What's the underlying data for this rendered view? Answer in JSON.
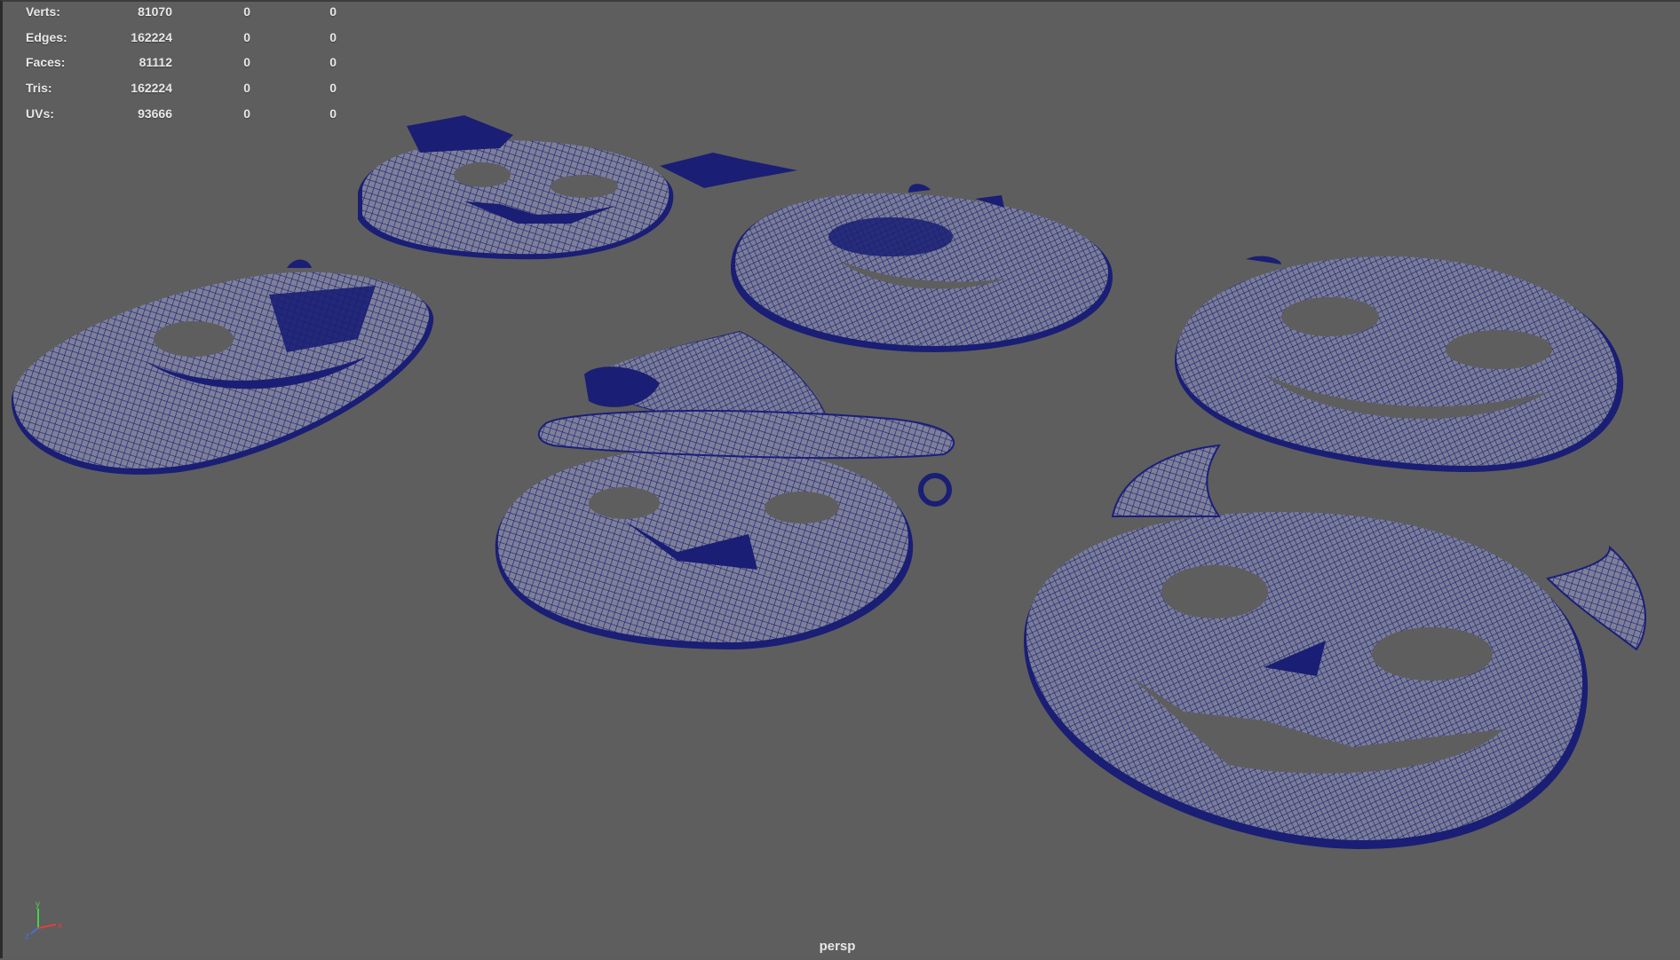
{
  "hud": {
    "rows": [
      {
        "label": "Verts:",
        "v1": "81070",
        "v2": "0",
        "v3": "0"
      },
      {
        "label": "Edges:",
        "v1": "162224",
        "v2": "0",
        "v3": "0"
      },
      {
        "label": "Faces:",
        "v1": "81112",
        "v2": "0",
        "v3": "0"
      },
      {
        "label": "Tris:",
        "v1": "162224",
        "v2": "0",
        "v3": "0"
      },
      {
        "label": "UVs:",
        "v1": "93666",
        "v2": "0",
        "v3": "0"
      }
    ]
  },
  "viewport": {
    "camera_label": "persp",
    "wire_color": "#1a1f7a",
    "background": "#5e5e5e"
  },
  "axis_gizmo": {
    "y": "y",
    "z": "z",
    "x": "x"
  }
}
